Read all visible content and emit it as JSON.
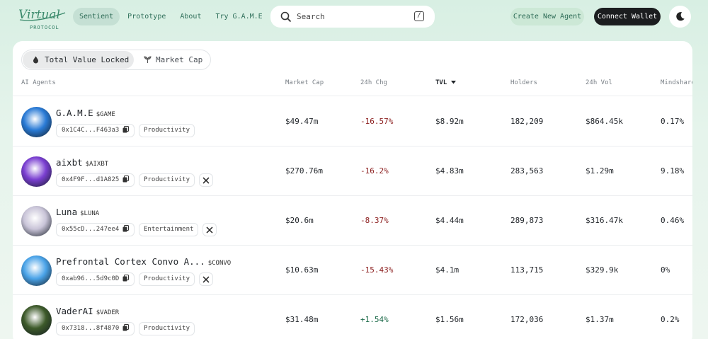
{
  "brand": {
    "logo_text": "Virtual",
    "sub": "PROTOCOL"
  },
  "nav": [
    {
      "label": "Sentient",
      "active": true
    },
    {
      "label": "Prototype",
      "active": false
    },
    {
      "label": "About",
      "active": false
    },
    {
      "label": "Try G.A.M.E",
      "active": false
    }
  ],
  "search": {
    "placeholder": "Search",
    "shortcut": "/"
  },
  "actions": {
    "create": "Create New Agent",
    "wallet": "Connect Wallet",
    "theme_icon": "moon-icon"
  },
  "segments": [
    {
      "label": "Total Value Locked",
      "icon": "drop-icon",
      "active": true
    },
    {
      "label": "Market Cap",
      "icon": "sprout-icon",
      "active": false
    }
  ],
  "columns": [
    "AI Agents",
    "Market Cap",
    "24h Chg",
    "TVL",
    "Holders",
    "24h Vol",
    "Mindshare"
  ],
  "sorted_column": "TVL",
  "rows": [
    {
      "name": "G.A.M.E",
      "ticker": "$GAME",
      "address": "0x1C4C...F463a3",
      "category": "Productivity",
      "x": false,
      "market_cap": "$49.47m",
      "change": "-16.57%",
      "change_dir": "neg",
      "tvl": "$8.92m",
      "holders": "182,209",
      "vol": "$864.45k",
      "mindshare": "0.17%",
      "avatar_color": "#2a7bd6"
    },
    {
      "name": "aixbt",
      "ticker": "$AIXBT",
      "address": "0x4F9F...d1A825",
      "category": "Productivity",
      "x": true,
      "market_cap": "$270.76m",
      "change": "-16.2%",
      "change_dir": "neg",
      "tvl": "$4.83m",
      "holders": "283,563",
      "vol": "$1.29m",
      "mindshare": "9.18%",
      "avatar_color": "#7a3fd1"
    },
    {
      "name": "Luna",
      "ticker": "$LUNA",
      "address": "0x55cD...247ee4",
      "category": "Entertainment",
      "x": true,
      "market_cap": "$20.6m",
      "change": "-8.37%",
      "change_dir": "neg",
      "tvl": "$4.44m",
      "holders": "289,873",
      "vol": "$316.47k",
      "mindshare": "0.46%",
      "avatar_color": "#c9c4d8"
    },
    {
      "name": "Prefrontal Cortex Convo A...",
      "ticker": "$CONVO",
      "address": "0xab96...5d9c0D",
      "category": "Productivity",
      "x": true,
      "market_cap": "$10.63m",
      "change": "-15.43%",
      "change_dir": "neg",
      "tvl": "$4.1m",
      "holders": "113,715",
      "vol": "$329.9k",
      "mindshare": "0%",
      "avatar_color": "#4aa3e8"
    },
    {
      "name": "VaderAI",
      "ticker": "$VADER",
      "address": "0x7318...8f4870",
      "category": "Productivity",
      "x": false,
      "market_cap": "$31.48m",
      "change": "+1.54%",
      "change_dir": "pos",
      "tvl": "$1.56m",
      "holders": "172,036",
      "vol": "$1.37m",
      "mindshare": "0.2%",
      "avatar_color": "#3d5a2a"
    }
  ]
}
